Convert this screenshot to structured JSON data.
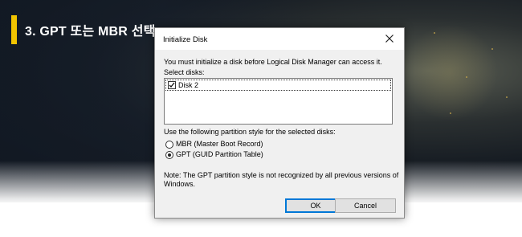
{
  "banner": {
    "heading": "3. GPT 또는 MBR 선택"
  },
  "dialog": {
    "title": "Initialize Disk",
    "intro": "You must initialize a disk before Logical Disk Manager can access it.",
    "select_label": "Select disks:",
    "disks": [
      {
        "label": "Disk 2",
        "checked": true
      }
    ],
    "partition_label": "Use the following partition style for the selected disks:",
    "options": [
      {
        "label": "MBR (Master Boot Record)",
        "selected": false
      },
      {
        "label": "GPT (GUID Partition Table)",
        "selected": true
      }
    ],
    "note_line1": "Note: The GPT partition style is not recognized by all previous versions of",
    "note_line2": "Windows.",
    "ok_label": "OK",
    "cancel_label": "Cancel",
    "close_icon": "close-icon"
  },
  "colors": {
    "accent_bar": "#f1c400",
    "dialog_bg": "#f0f0f0",
    "default_button_border": "#0078d7"
  }
}
